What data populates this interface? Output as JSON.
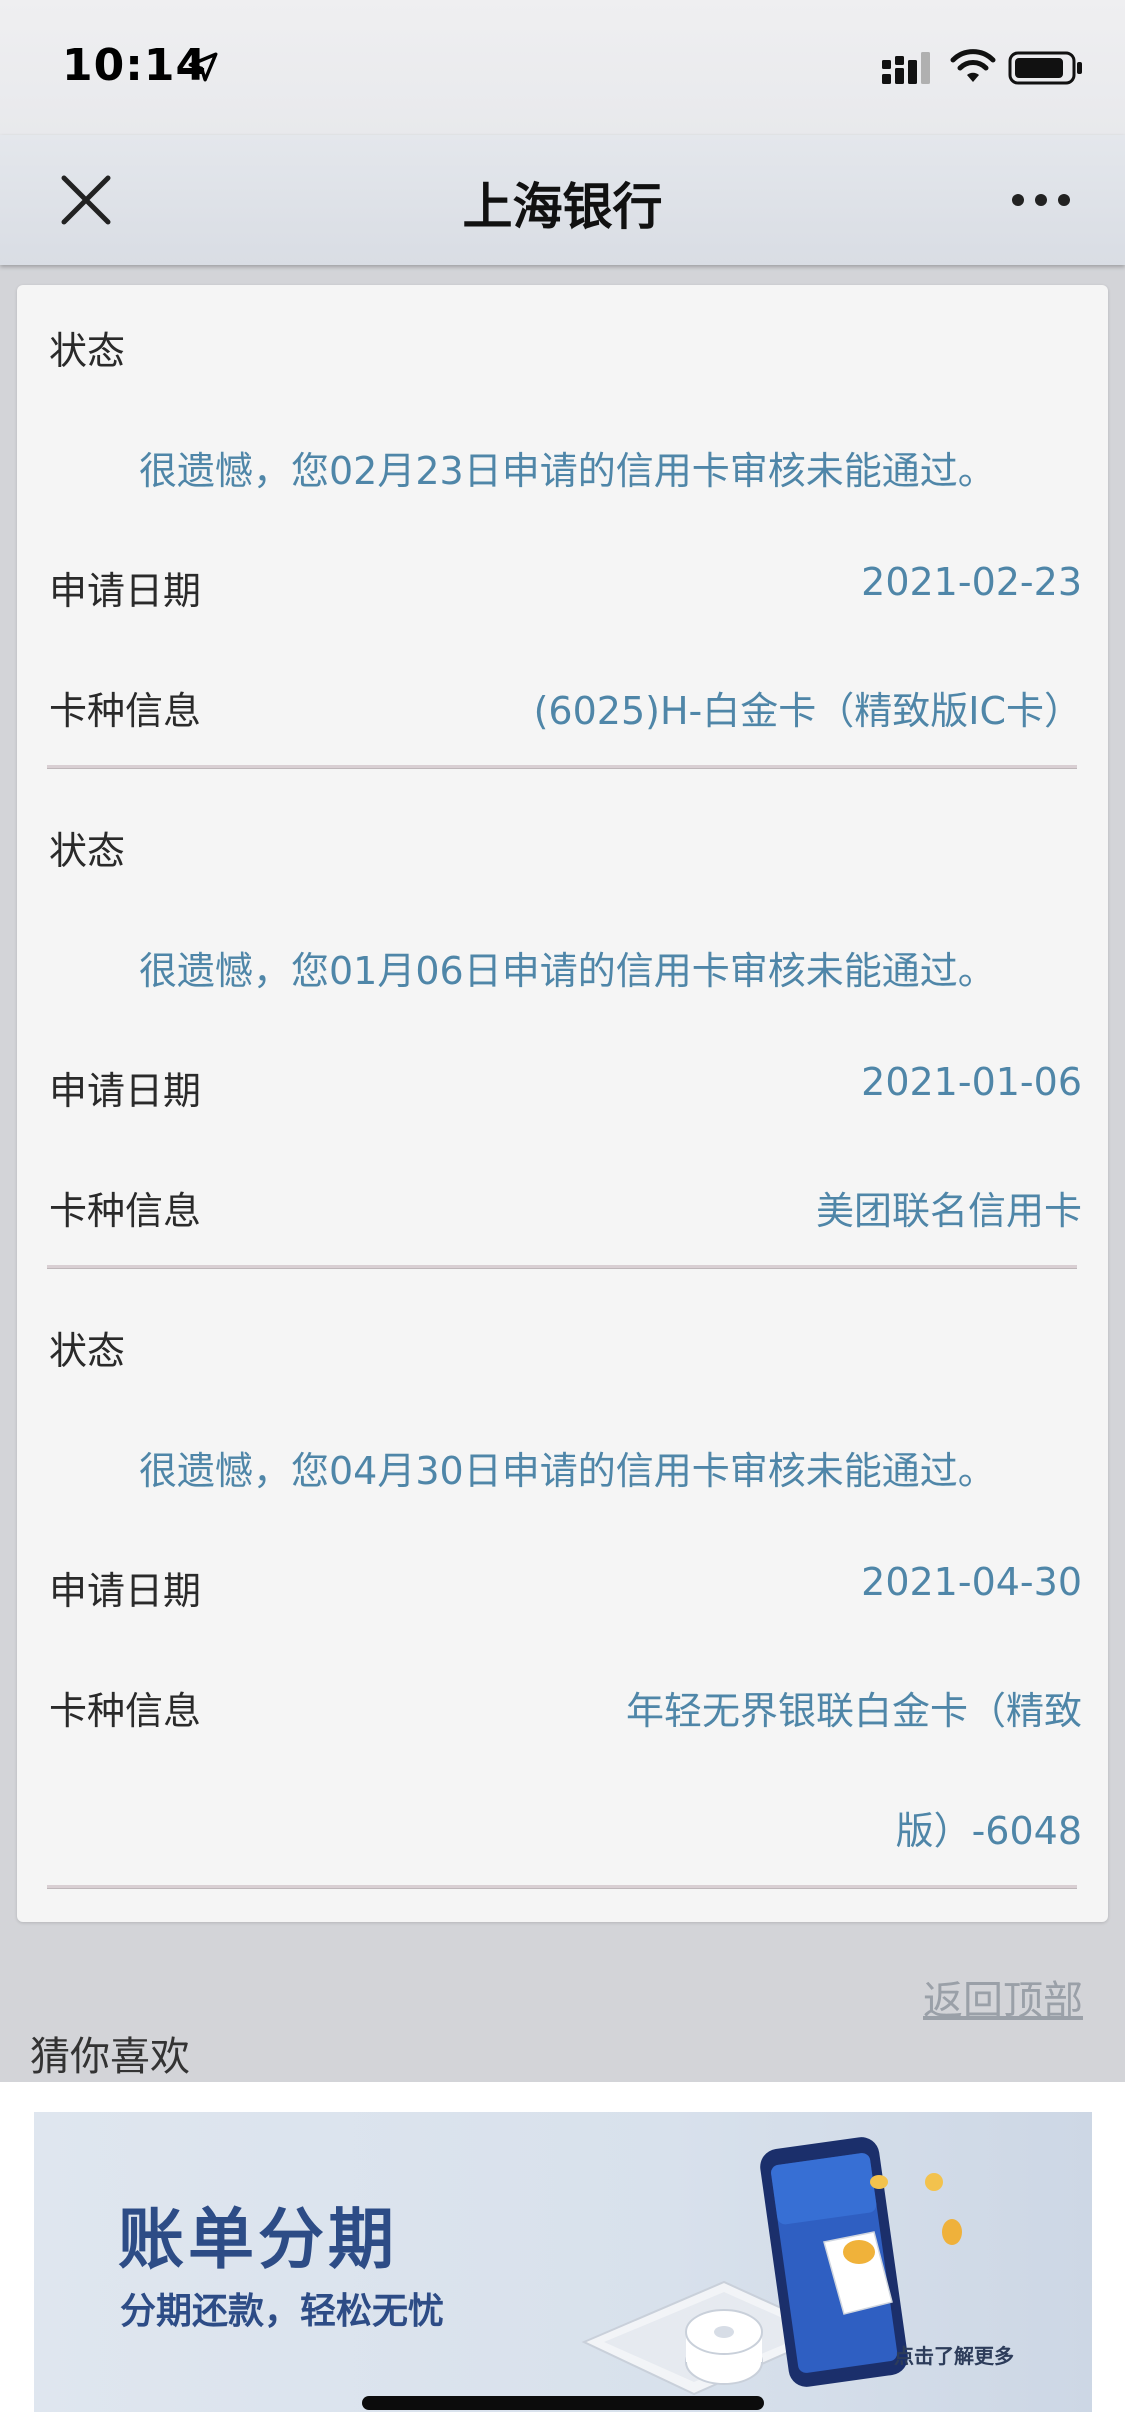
{
  "status_bar": {
    "time": "10:14"
  },
  "nav": {
    "title": "上海银行"
  },
  "labels": {
    "status": "状态",
    "apply_date": "申请日期",
    "card_info": "卡种信息"
  },
  "records": [
    {
      "message": "很遗憾，您02月23日申请的信用卡审核未能通过。",
      "date": "2021-02-23",
      "card": "(6025)H-白金卡（精致版IC卡）"
    },
    {
      "message": "很遗憾，您01月06日申请的信用卡审核未能通过。",
      "date": "2021-01-06",
      "card": "美团联名信用卡"
    },
    {
      "message": "很遗憾，您04月30日申请的信用卡审核未能通过。",
      "date": "2021-04-30",
      "card_line1": "年轻无界银联白金卡（精致",
      "card_line2": "版）-6048"
    }
  ],
  "back_to_top": "返回顶部",
  "recommend": {
    "heading": "猜你喜欢",
    "banner_title": "账单分期",
    "banner_subtitle": "分期还款，轻松无忧",
    "banner_cta": "点击了解更多"
  },
  "colors": {
    "value_blue": "#4f86a8",
    "banner_navy": "#2d4c86"
  }
}
